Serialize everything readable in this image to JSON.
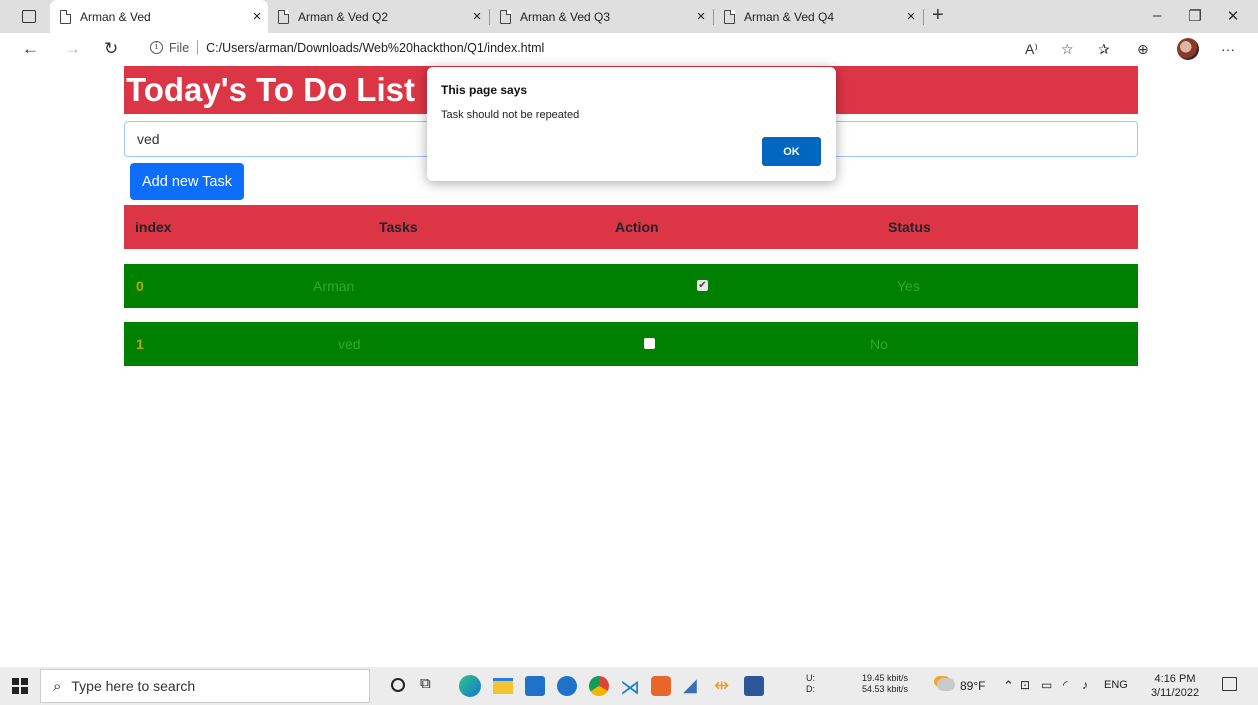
{
  "browser": {
    "tabs": [
      {
        "title": "Arman & Ved",
        "active": true
      },
      {
        "title": "Arman & Ved Q2",
        "active": false
      },
      {
        "title": "Arman & Ved Q3",
        "active": false
      },
      {
        "title": "Arman & Ved Q4",
        "active": false
      }
    ],
    "tab_close_glyph": "×",
    "new_tab_glyph": "+",
    "address": {
      "file_label": "File",
      "url": "C:/Users/arman/Downloads/Web%20hackthon/Q1/index.html"
    }
  },
  "app": {
    "heading": "Today's To Do List",
    "task_input_value": "ved",
    "add_button_label": "Add new Task",
    "table_headers": {
      "index": "index",
      "tasks": "Tasks",
      "action": "Action",
      "status": "Status"
    },
    "rows": [
      {
        "index": "0",
        "task": "Arman",
        "checked": true,
        "status": "Yes"
      },
      {
        "index": "1",
        "task": "ved",
        "checked": false,
        "status": "No"
      }
    ]
  },
  "dialog": {
    "title": "This page says",
    "message": "Task should not be repeated",
    "ok_label": "OK"
  },
  "taskbar": {
    "search_placeholder": "Type here to search",
    "net_up_label": "U:",
    "net_down_label": "D:",
    "net_up": "19.45 kbit/s",
    "net_down": "54.53 kbit/s",
    "weather": "89°F",
    "language": "ENG",
    "time": "4:16 PM",
    "date": "3/11/2022"
  },
  "colors": {
    "danger": "#dc3545",
    "row_green": "#008000",
    "primary": "#0d6efd",
    "dialog_ok": "#0067c0"
  }
}
